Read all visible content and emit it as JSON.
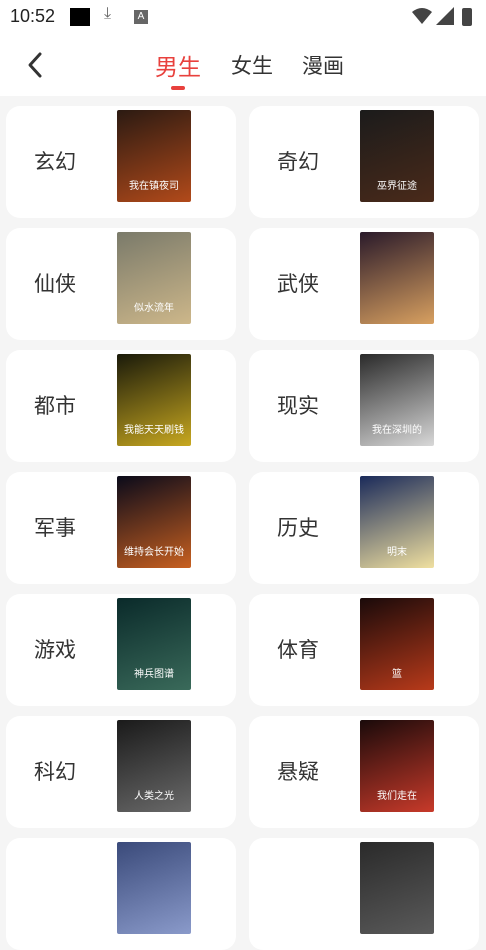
{
  "status": {
    "time": "10:52"
  },
  "header": {
    "tabs": [
      "男生",
      "女生",
      "漫画"
    ]
  },
  "categories": [
    {
      "label": "玄幻",
      "cover_text": "我在镇夜司",
      "colors": [
        "#2b1a12",
        "#b24a1a"
      ]
    },
    {
      "label": "奇幻",
      "cover_text": "巫界征途",
      "colors": [
        "#1b1b1b",
        "#4a2a1a"
      ]
    },
    {
      "label": "仙侠",
      "cover_text": "似水流年",
      "colors": [
        "#7a7a6a",
        "#cdb78a"
      ]
    },
    {
      "label": "武侠",
      "cover_text": "",
      "colors": [
        "#2a1a2a",
        "#d8a060"
      ]
    },
    {
      "label": "都市",
      "cover_text": "我能天天刷钱",
      "colors": [
        "#1a1a0a",
        "#c8a820"
      ]
    },
    {
      "label": "现实",
      "cover_text": "我在深圳的",
      "colors": [
        "#2a2a2a",
        "#d8d8d8"
      ]
    },
    {
      "label": "军事",
      "cover_text": "维持会长开始",
      "colors": [
        "#0a0a1a",
        "#c86020"
      ]
    },
    {
      "label": "历史",
      "cover_text": "明末",
      "colors": [
        "#1a2a5a",
        "#f0e0a0"
      ]
    },
    {
      "label": "游戏",
      "cover_text": "神兵图谱",
      "colors": [
        "#0a2a2a",
        "#3a6a5a"
      ]
    },
    {
      "label": "体育",
      "cover_text": "篮",
      "colors": [
        "#1a0a0a",
        "#b83a1a"
      ]
    },
    {
      "label": "科幻",
      "cover_text": "人类之光",
      "colors": [
        "#1a1a1a",
        "#6a6a6a"
      ]
    },
    {
      "label": "悬疑",
      "cover_text": "我们走在",
      "colors": [
        "#1a0a0a",
        "#c83a2a"
      ]
    },
    {
      "label": "",
      "cover_text": "",
      "colors": [
        "#3a4a7a",
        "#8a9aca"
      ]
    },
    {
      "label": "",
      "cover_text": "",
      "colors": [
        "#2a2a2a",
        "#5a5a5a"
      ]
    }
  ]
}
